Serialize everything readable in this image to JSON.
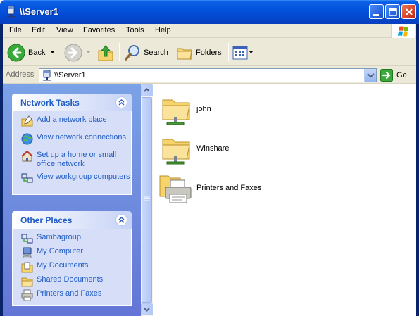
{
  "window": {
    "title": "\\\\Server1"
  },
  "menu": [
    "File",
    "Edit",
    "View",
    "Favorites",
    "Tools",
    "Help"
  ],
  "toolbar": {
    "back": "Back",
    "search": "Search",
    "folders": "Folders"
  },
  "address": {
    "label": "Address",
    "value": "\\\\Server1",
    "go": "Go"
  },
  "network_tasks": {
    "title": "Network Tasks",
    "items": [
      "Add a network place",
      "View network connections",
      "Set up a home or small office network",
      "View workgroup computers"
    ]
  },
  "other_places": {
    "title": "Other Places",
    "items": [
      "Sambagroup",
      "My Computer",
      "My Documents",
      "Shared Documents",
      "Printers and Faxes"
    ]
  },
  "files": [
    "john",
    "Winshare",
    "Printers and Faxes"
  ]
}
